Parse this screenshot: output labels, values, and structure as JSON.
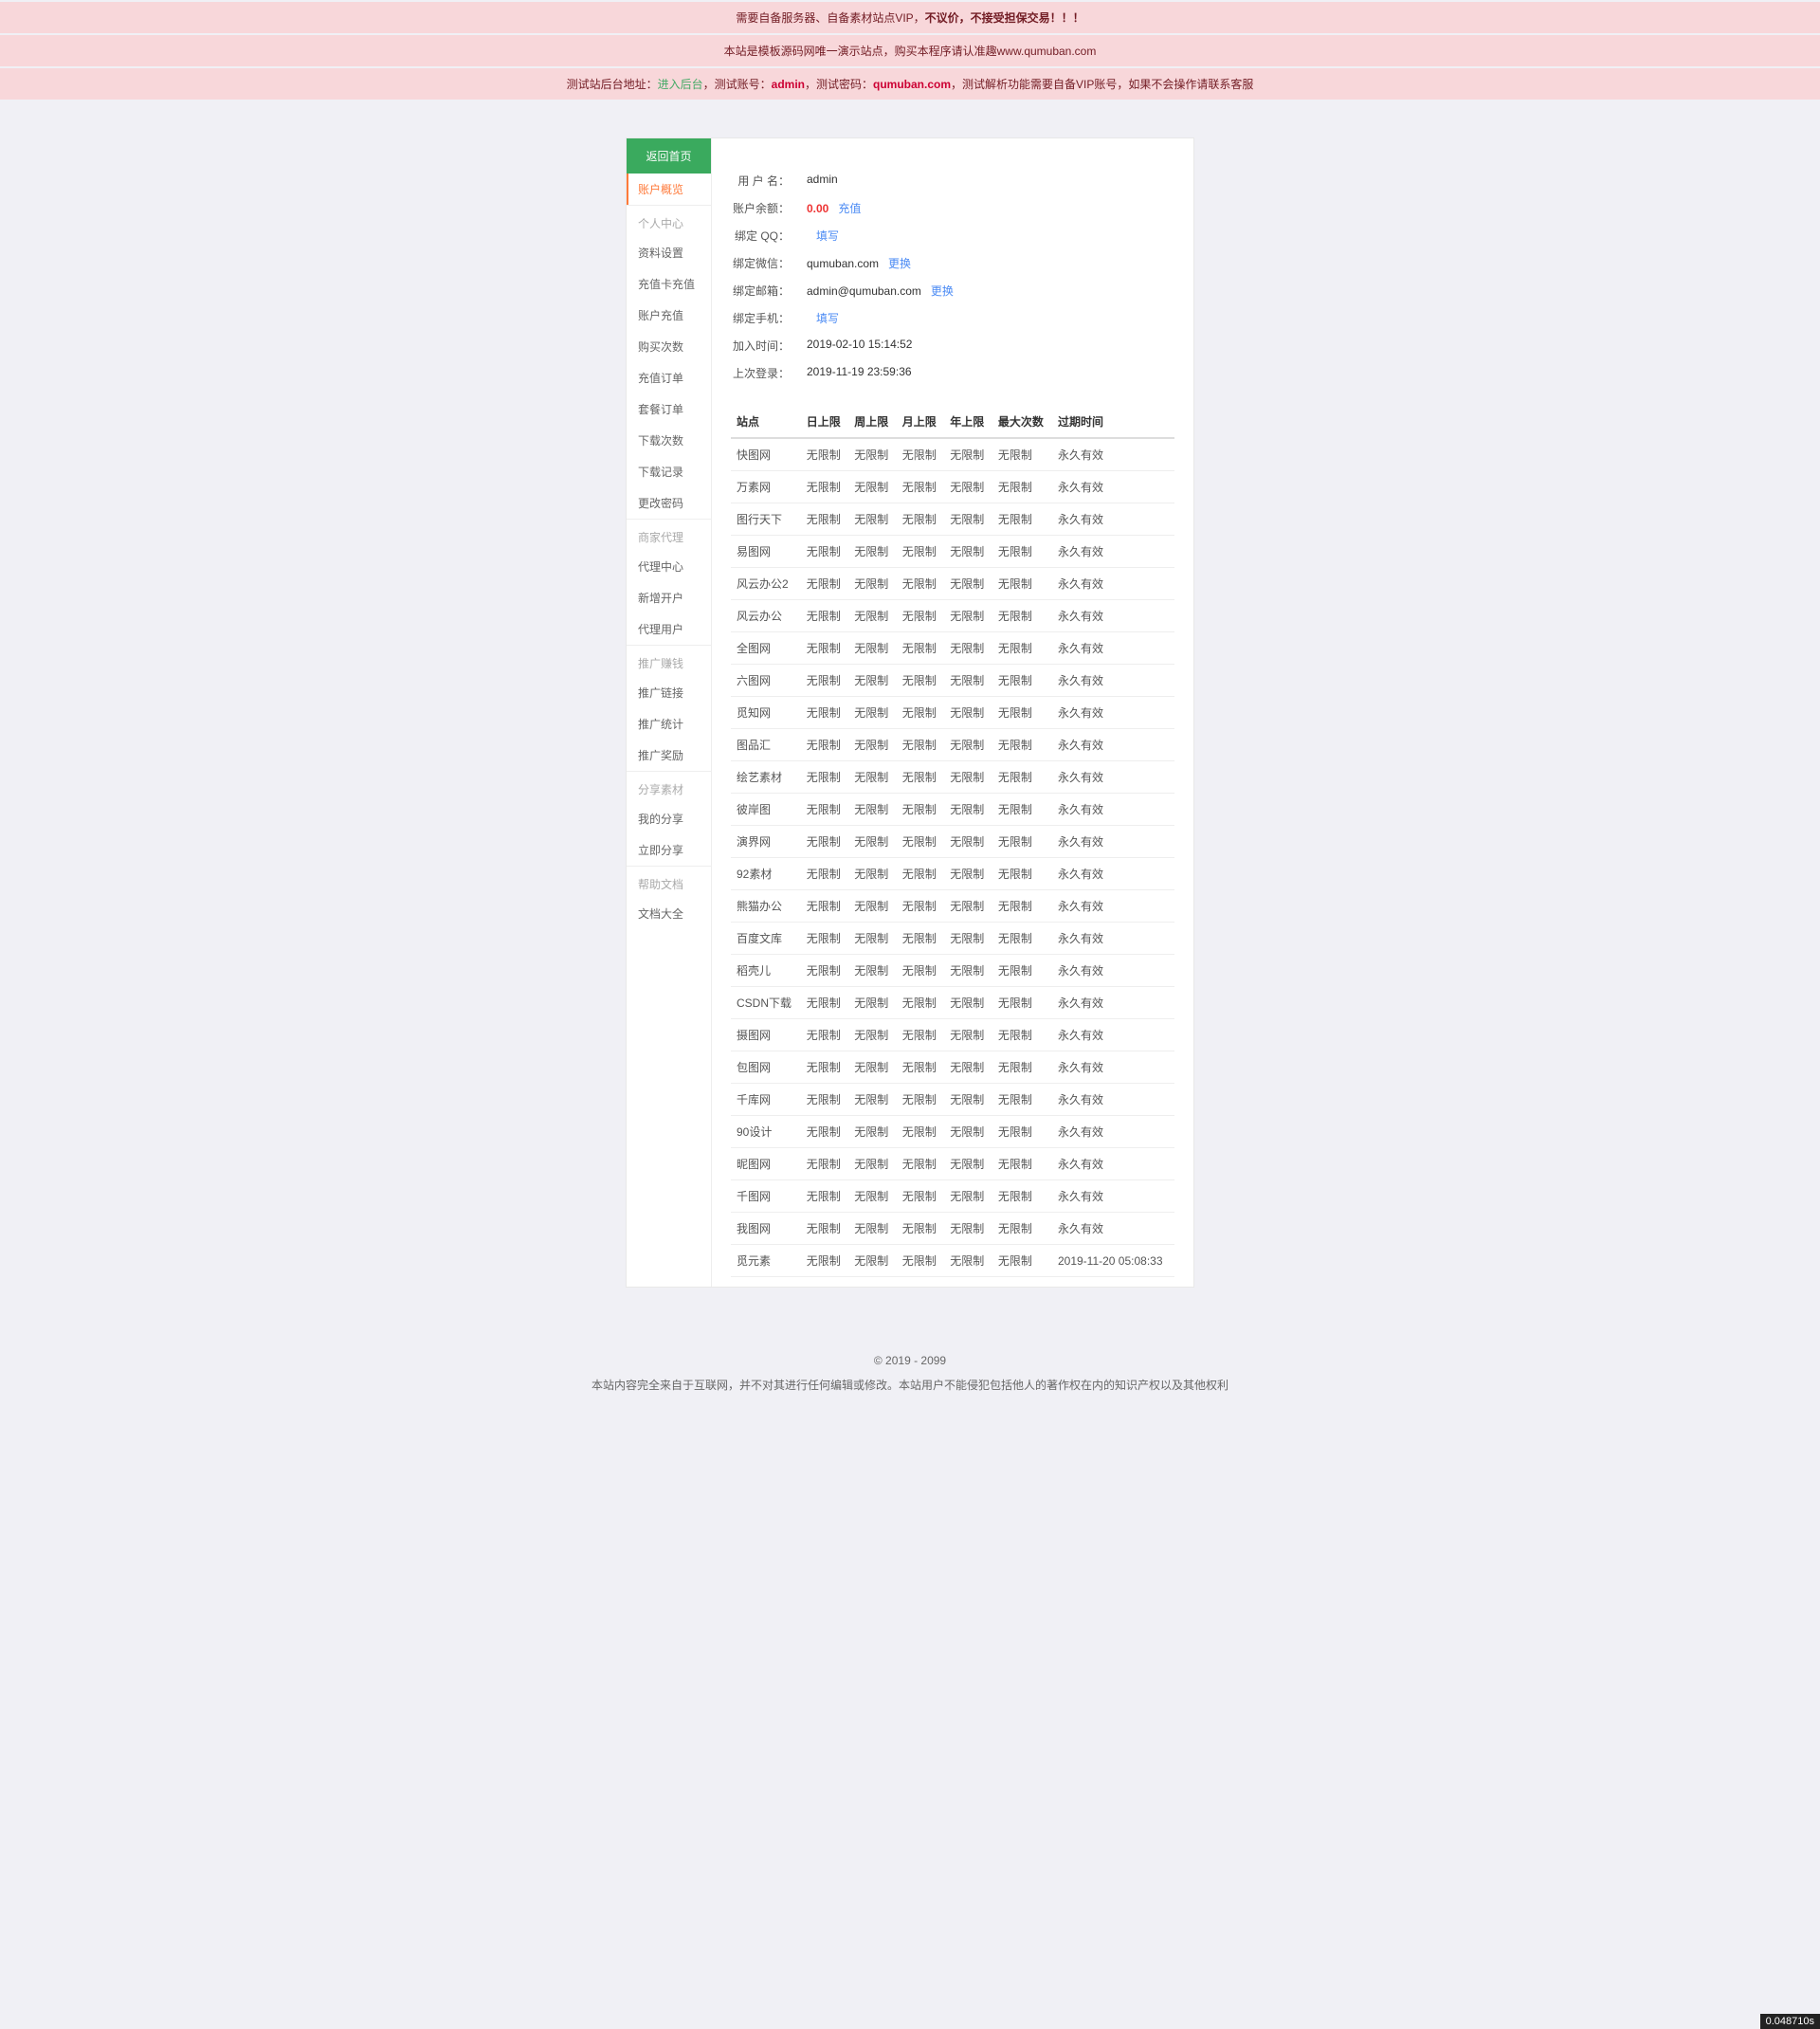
{
  "alerts": {
    "a1_pre": "需要自备服务器、自备素材站点VIP，",
    "a1_bold": "不议价，不接受担保交易！！！",
    "a2": "本站是模板源码网唯一演示站点，购买本程序请认准趣www.qumuban.com",
    "a3_pre": "测试站后台地址：",
    "a3_link": "进入后台",
    "a3_mid1": "，测试账号：",
    "a3_admin": "admin",
    "a3_mid2": "，测试密码：",
    "a3_pwd": "qumuban.com",
    "a3_suf": "，测试解析功能需要自备VIP账号，如果不会操作请联系客服"
  },
  "sidebar": {
    "home": "返回首页",
    "overviews": "账户概览",
    "groups": [
      {
        "title": "个人中心",
        "items": [
          "资料设置",
          "充值卡充值",
          "账户充值",
          "购买次数",
          "充值订单",
          "套餐订单",
          "下载次数",
          "下载记录",
          "更改密码"
        ]
      },
      {
        "title": "商家代理",
        "items": [
          "代理中心",
          "新增开户",
          "代理用户"
        ]
      },
      {
        "title": "推广赚钱",
        "items": [
          "推广链接",
          "推广统计",
          "推广奖励"
        ]
      },
      {
        "title": "分享素材",
        "items": [
          "我的分享",
          "立即分享"
        ]
      },
      {
        "title": "帮助文档",
        "items": [
          "文档大全"
        ]
      }
    ]
  },
  "info": {
    "rows": [
      {
        "label": "用 户 名：",
        "value": "admin"
      },
      {
        "label": "账户余额：",
        "value": "0.00",
        "red": true,
        "link": "充值"
      },
      {
        "label": "绑定 QQ：",
        "value": "",
        "link": "填写"
      },
      {
        "label": "绑定微信：",
        "value": "qumuban.com",
        "link": "更换"
      },
      {
        "label": "绑定邮箱：",
        "value": "admin@qumuban.com",
        "link": "更换"
      },
      {
        "label": "绑定手机：",
        "value": "",
        "link": "填写"
      },
      {
        "label": "加入时间：",
        "value": "2019-02-10 15:14:52"
      },
      {
        "label": "上次登录：",
        "value": "2019-11-19 23:59:36"
      }
    ]
  },
  "table": {
    "headers": [
      "站点",
      "日上限",
      "周上限",
      "月上限",
      "年上限",
      "最大次数",
      "过期时间"
    ],
    "unlimited": "无限制",
    "perm": "永久有效",
    "rows": [
      {
        "site": "快图网",
        "exp": "永久有效"
      },
      {
        "site": "万素网",
        "exp": "永久有效"
      },
      {
        "site": "图行天下",
        "exp": "永久有效"
      },
      {
        "site": "易图网",
        "exp": "永久有效"
      },
      {
        "site": "风云办公2",
        "exp": "永久有效"
      },
      {
        "site": "风云办公",
        "exp": "永久有效"
      },
      {
        "site": "全图网",
        "exp": "永久有效"
      },
      {
        "site": "六图网",
        "exp": "永久有效"
      },
      {
        "site": "觅知网",
        "exp": "永久有效"
      },
      {
        "site": "图品汇",
        "exp": "永久有效"
      },
      {
        "site": "绘艺素材",
        "exp": "永久有效"
      },
      {
        "site": "彼岸图",
        "exp": "永久有效"
      },
      {
        "site": "演界网",
        "exp": "永久有效"
      },
      {
        "site": "92素材",
        "exp": "永久有效"
      },
      {
        "site": "熊猫办公",
        "exp": "永久有效"
      },
      {
        "site": "百度文库",
        "exp": "永久有效"
      },
      {
        "site": "稻壳儿",
        "exp": "永久有效"
      },
      {
        "site": "CSDN下载",
        "exp": "永久有效"
      },
      {
        "site": "摄图网",
        "exp": "永久有效"
      },
      {
        "site": "包图网",
        "exp": "永久有效"
      },
      {
        "site": "千库网",
        "exp": "永久有效"
      },
      {
        "site": "90设计",
        "exp": "永久有效"
      },
      {
        "site": "昵图网",
        "exp": "永久有效"
      },
      {
        "site": "千图网",
        "exp": "永久有效"
      },
      {
        "site": "我图网",
        "exp": "永久有效"
      },
      {
        "site": "觅元素",
        "exp": "2019-11-20 05:08:33"
      }
    ]
  },
  "footer": {
    "copy": "© 2019 - 2099",
    "note": "本站内容完全来自于互联网，并不对其进行任何编辑或修改。本站用户不能侵犯包括他人的著作权在内的知识产权以及其他权利"
  },
  "perf": "0.048710s"
}
